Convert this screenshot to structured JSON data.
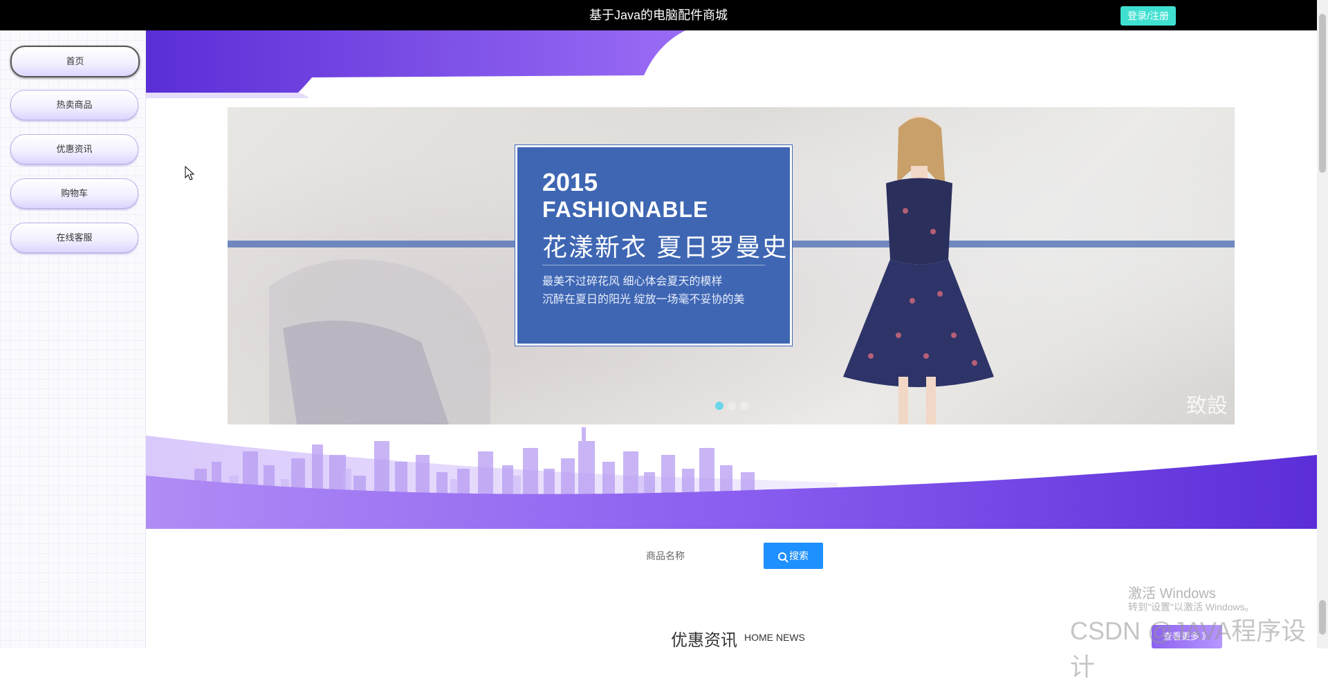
{
  "header": {
    "title": "基于Java的电脑配件商城",
    "login_label": "登录/注册"
  },
  "sidebar": {
    "items": [
      {
        "label": "首页",
        "active": true
      },
      {
        "label": "热卖商品",
        "active": false
      },
      {
        "label": "优惠资讯",
        "active": false
      },
      {
        "label": "购物车",
        "active": false
      },
      {
        "label": "在线客服",
        "active": false
      }
    ]
  },
  "banner": {
    "year": "2015",
    "headline": "FASHIONABLE",
    "cn_title": "花漾新衣  夏日罗曼史",
    "line1": "最美不过碎花风 细心体会夏天的模样",
    "line2": "沉醉在夏日的阳光 绽放一场毫不妥协的美",
    "mark": "致設",
    "slides": 3,
    "active_slide": 1
  },
  "search": {
    "placeholder": "商品名称",
    "button_label": "搜索"
  },
  "section": {
    "title": "优惠资讯",
    "subtitle": "HOME NEWS",
    "more_label": "查看更多 》"
  },
  "overlay": {
    "windows_line1": "激活 Windows",
    "windows_line2": "转到\"设置\"以激活 Windows。",
    "watermark": "CSDN @JAVA程序设计"
  },
  "colors": {
    "accent_purple": "#6a3de8",
    "search_blue": "#1e90ff",
    "login_teal": "#40e0d0",
    "banner_box": "#3e66b3"
  }
}
